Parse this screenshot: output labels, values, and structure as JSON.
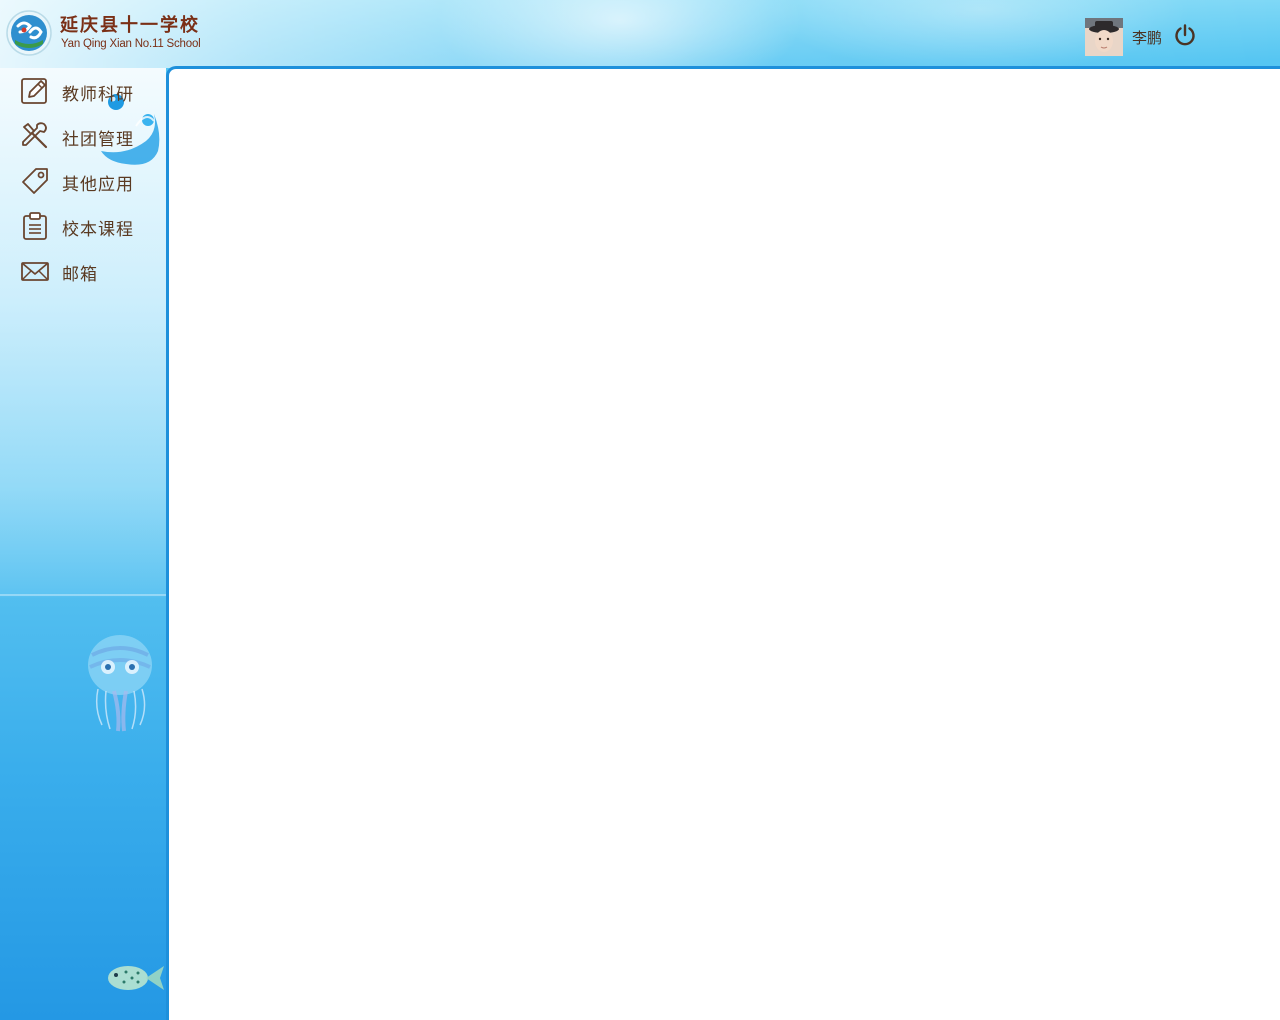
{
  "header": {
    "school_name": "延庆县十一学校",
    "school_name_en": "Yan Qing Xian No.11 School",
    "user_name": "李鹏"
  },
  "sidebar": {
    "items": [
      {
        "label": "教师科研",
        "icon": "pencil-square-icon"
      },
      {
        "label": "社团管理",
        "icon": "tools-icon"
      },
      {
        "label": "其他应用",
        "icon": "tag-icon"
      },
      {
        "label": "校本课程",
        "icon": "clipboard-icon"
      },
      {
        "label": "邮箱",
        "icon": "envelope-icon"
      }
    ]
  },
  "colors": {
    "accent": "#1e90db",
    "text_brown": "#5a3a22",
    "brand_red": "#7a2f16"
  }
}
